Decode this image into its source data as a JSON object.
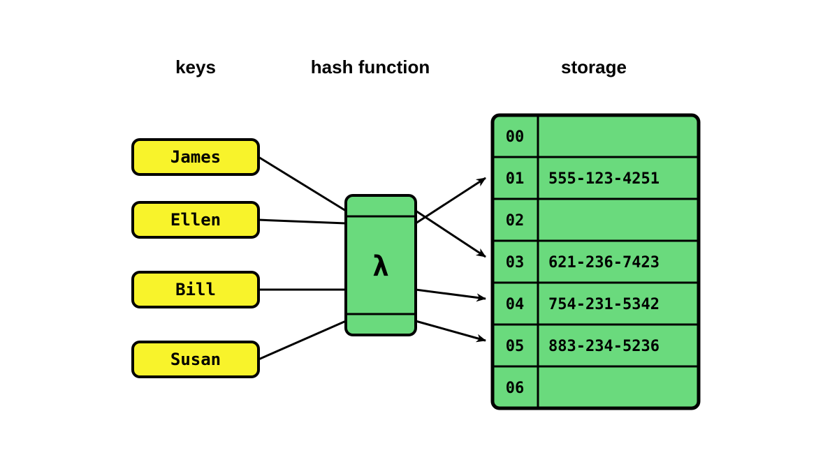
{
  "headings": {
    "keys": "keys",
    "hash_function": "hash function",
    "storage": "storage"
  },
  "keys": [
    "James",
    "Ellen",
    "Bill",
    "Susan"
  ],
  "hash_function": {
    "symbol": "λ"
  },
  "storage": [
    {
      "index": "00",
      "value": ""
    },
    {
      "index": "01",
      "value": "555-123-4251"
    },
    {
      "index": "02",
      "value": ""
    },
    {
      "index": "03",
      "value": "621-236-7423"
    },
    {
      "index": "04",
      "value": "754-231-5342"
    },
    {
      "index": "05",
      "value": "883-234-5236"
    },
    {
      "index": "06",
      "value": ""
    }
  ],
  "colors": {
    "key_fill": "#f8f32b",
    "slot_fill": "#6ada7d",
    "stroke": "#000000"
  },
  "chart_data": {
    "type": "diagram",
    "title": "Hash function mapping keys to storage slots",
    "mappings": [
      {
        "key": "James",
        "slot": "03",
        "value": "621-236-7423"
      },
      {
        "key": "Ellen",
        "slot": "01",
        "value": "555-123-4251"
      },
      {
        "key": "Bill",
        "slot": "04",
        "value": "754-231-5342"
      },
      {
        "key": "Susan",
        "slot": "05",
        "value": "883-234-5236"
      }
    ],
    "storage_size": 7
  }
}
